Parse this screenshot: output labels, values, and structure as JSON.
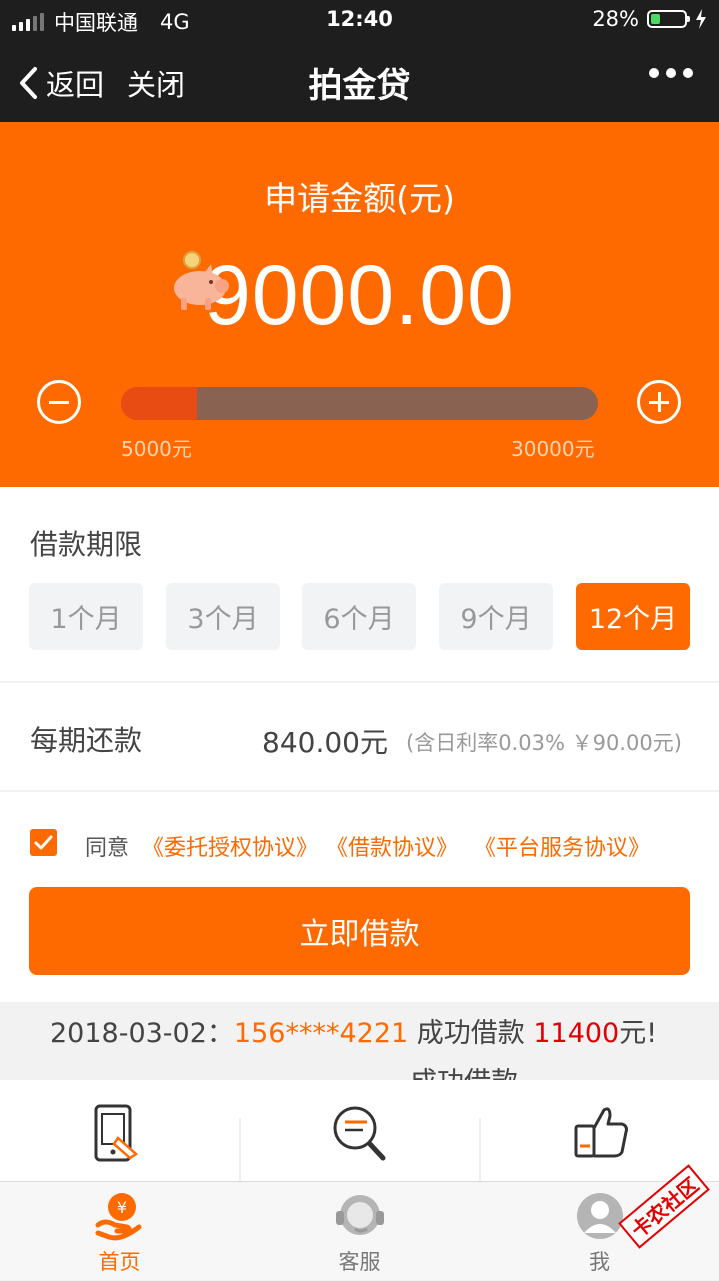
{
  "status_bar": {
    "carrier": "中国联通",
    "network": "4G",
    "time": "12:40",
    "battery_percent": "28%",
    "battery_level": 0.28
  },
  "navbar": {
    "back_label": "返回",
    "close_label": "关闭",
    "title": "拍金贷"
  },
  "loan": {
    "amount_label": "申请金额(元)",
    "amount": "9000.00",
    "min_label": "5000元",
    "max_label": "30000元",
    "slider_fraction": 0.16
  },
  "term": {
    "title": "借款期限",
    "options": [
      {
        "label": "1个月",
        "selected": false
      },
      {
        "label": "3个月",
        "selected": false
      },
      {
        "label": "6个月",
        "selected": false
      },
      {
        "label": "9个月",
        "selected": false
      },
      {
        "label": "12个月",
        "selected": true
      }
    ]
  },
  "repayment": {
    "label": "每期还款",
    "amount": "840.00元",
    "note": "(含日利率0.03% ￥90.00元)"
  },
  "agreement": {
    "checked": true,
    "agree_label": "同意",
    "links": [
      "《委托授权协议》",
      "《借款协议》",
      "《平台服务协议》"
    ]
  },
  "submit_label": "立即借款",
  "ticker": {
    "date": "2018-03-02：",
    "phone": "156****4221",
    "text": " 成功借款 ",
    "amount": "11400",
    "unit": "元!",
    "next_partial": "成功借款"
  },
  "features": [
    {
      "icon": "phone-touch-icon"
    },
    {
      "icon": "search-document-icon"
    },
    {
      "icon": "thumbs-up-icon"
    }
  ],
  "tabs": [
    {
      "label": "首页",
      "icon": "home-money-icon",
      "active": true
    },
    {
      "label": "客服",
      "icon": "customer-service-icon",
      "active": false
    },
    {
      "label": "我",
      "icon": "user-icon",
      "active": false
    }
  ],
  "watermark": "卡农社区",
  "colors": {
    "accent": "#ff6a00",
    "header_bg": "#1e1e1e",
    "ticker_amount": "#e30000"
  }
}
